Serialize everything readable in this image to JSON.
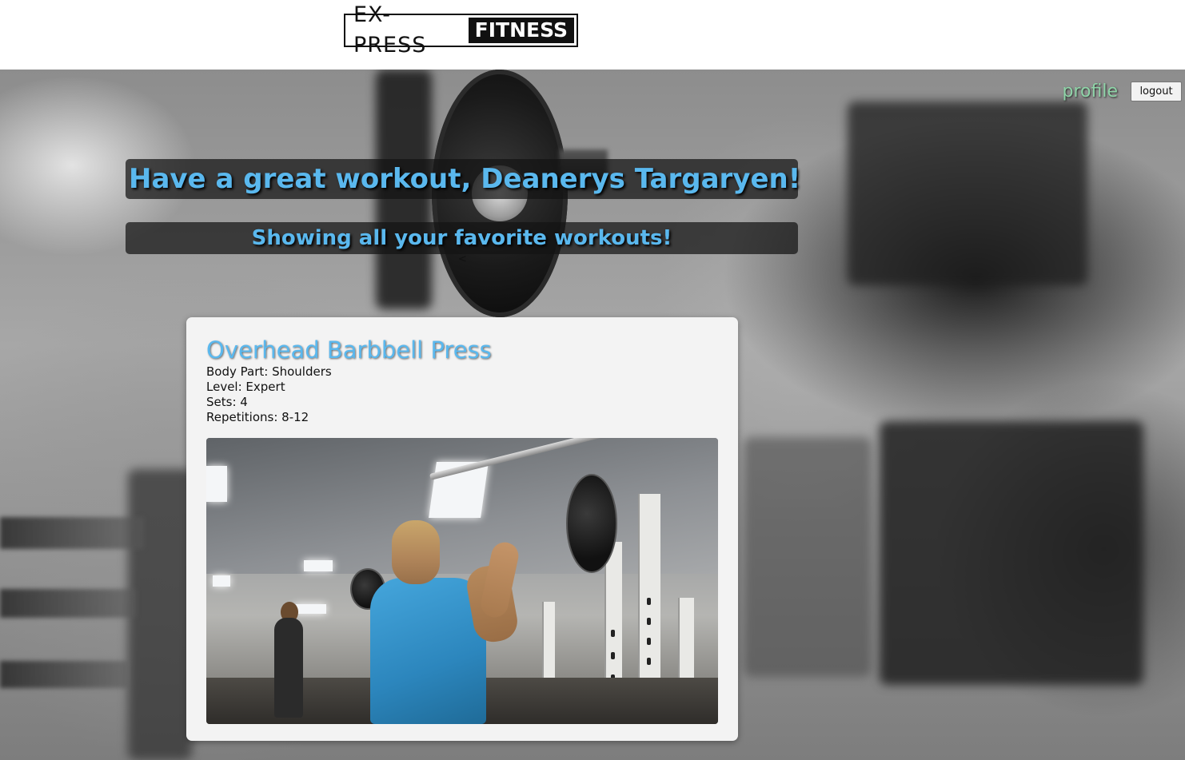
{
  "logo": {
    "left_text": "EX-PRESS",
    "right_text": "FITNESS"
  },
  "nav": {
    "profile_label": "profile",
    "logout_label": "logout"
  },
  "hero": {
    "greeting": "Have a great workout, Deanerys Targaryen!",
    "subtitle": "Showing all your favorite workouts!",
    "carousel_prev": "<"
  },
  "workout": {
    "title": "Overhead Barbbell Press",
    "body_part_label": "Body Part: Shoulders",
    "level_label": "Level: Expert",
    "sets_label": "Sets: 4",
    "reps_label": "Repetitions: 8-12"
  },
  "colors": {
    "accent_blue": "#5ab8ee",
    "profile_green": "#8fd4a8",
    "card_bg": "#f3f3f3"
  }
}
